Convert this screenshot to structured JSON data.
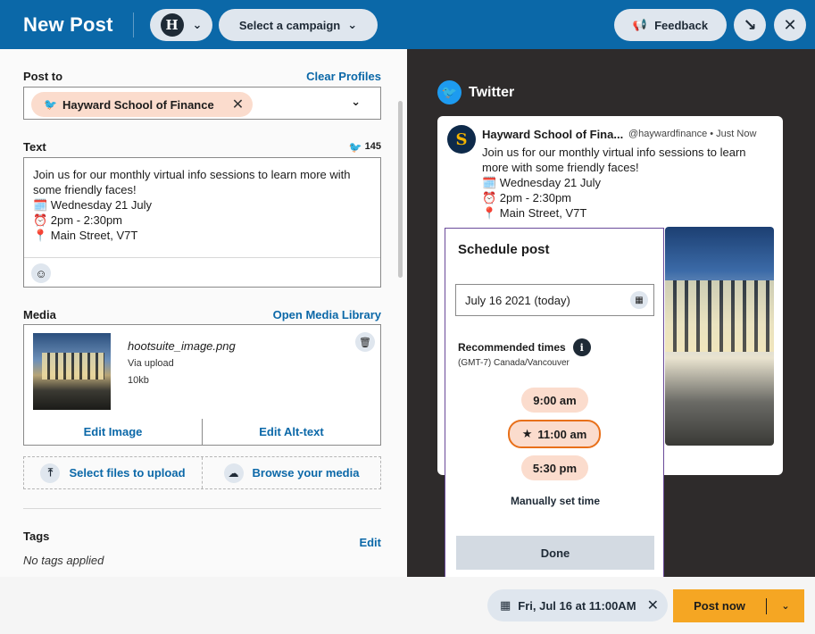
{
  "header": {
    "title": "New Post",
    "profile_logo": "H",
    "campaign_label": "Select a campaign",
    "feedback_label": "Feedback"
  },
  "post_to": {
    "label": "Post to",
    "clear_label": "Clear Profiles",
    "profile_chip": "Hayward School of Finance"
  },
  "text": {
    "label": "Text",
    "char_count": "145",
    "lines": [
      "Join us for our monthly virtual info sessions to learn more with",
      "some friendly faces!",
      "🗓️ Wednesday 21 July",
      "⏰ 2pm - 2:30pm",
      "📍 Main Street, V7T"
    ]
  },
  "media": {
    "label": "Media",
    "library_link": "Open Media Library",
    "filename": "hootsuite_image.png",
    "source": "Via upload",
    "size": "10kb",
    "edit_image": "Edit Image",
    "edit_alt": "Edit Alt-text",
    "select_files": "Select files to upload",
    "browse": "Browse your media"
  },
  "tags": {
    "label": "Tags",
    "edit": "Edit",
    "empty": "No tags applied"
  },
  "preview": {
    "network": "Twitter",
    "name": "Hayward School of Fina...",
    "meta": "@haywardfinance  •  Just Now",
    "lines": [
      "Join us for our monthly virtual info sessions to learn",
      "more with some friendly faces!",
      "🗓️ Wednesday 21 July",
      "⏰ 2pm - 2:30pm",
      "📍 Main Street, V7T"
    ]
  },
  "schedule": {
    "title": "Schedule post",
    "date": "July 16  2021  (today)",
    "recommended_label": "Recommended times",
    "timezone": "(GMT-7) Canada/Vancouver",
    "times": [
      "9:00 am",
      "11:00 am",
      "5:30 pm"
    ],
    "selected_time_index": 1,
    "manual": "Manually set time",
    "done": "Done"
  },
  "footer": {
    "scheduled": "Fri, Jul 16 at 11:00AM",
    "post_now": "Post now"
  },
  "colors": {
    "brand_blue": "#0b68a8",
    "chip_peach": "#fbdccd",
    "accent_orange": "#e8701a",
    "post_yellow": "#f5a623",
    "twitter_blue": "#1d9bf0"
  }
}
